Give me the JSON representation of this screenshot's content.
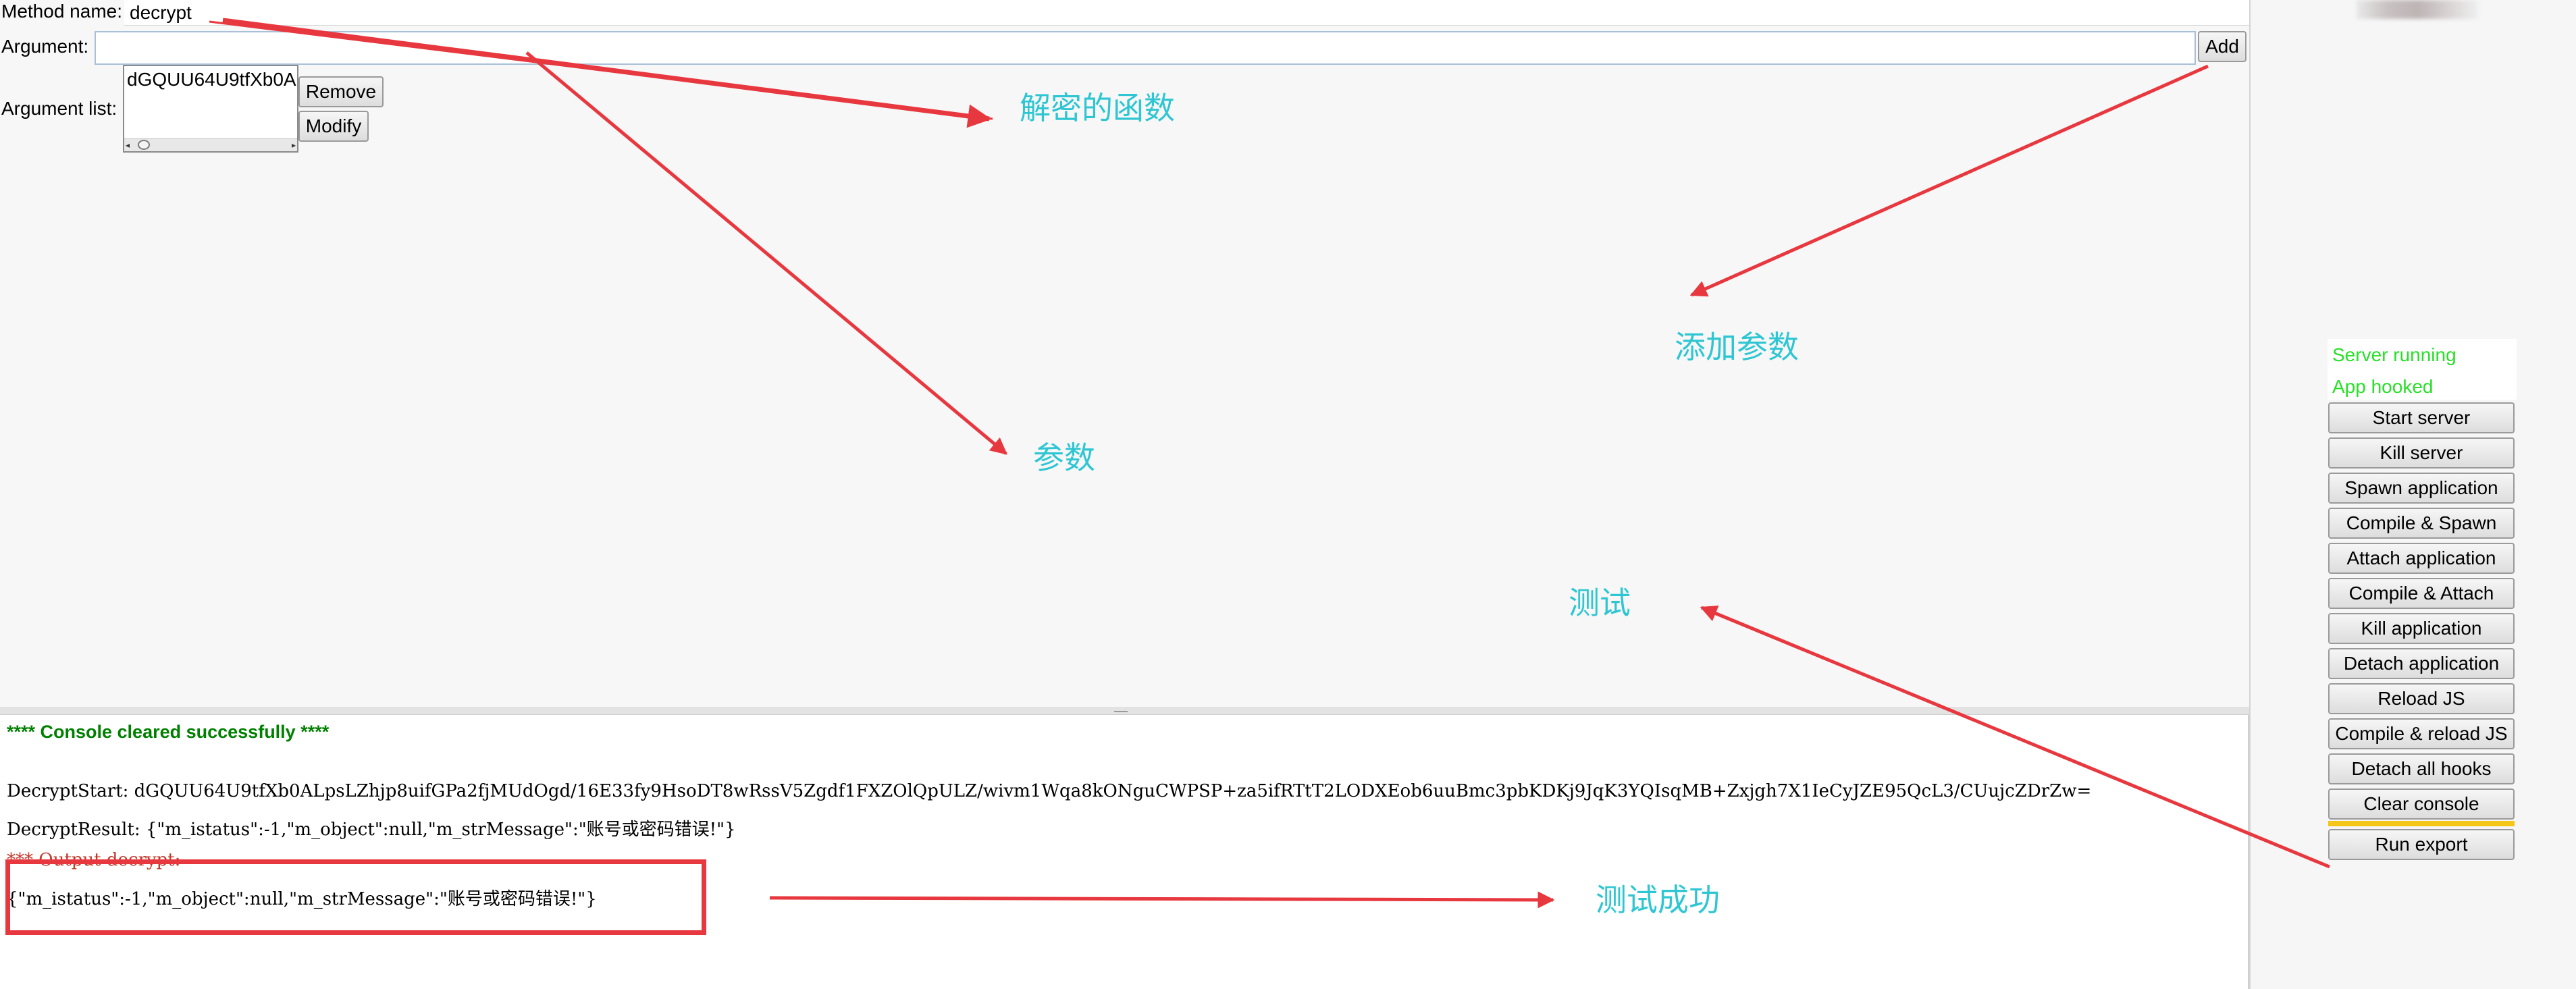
{
  "top_form": {
    "method_name_label": "Method name:",
    "method_name_value": "decrypt",
    "argument_label": "Argument:",
    "argument_value": "",
    "add_button": "Add",
    "argument_list_label": "Argument list:",
    "argument_list_items": [
      "dGQUU64U9tfXb0A"
    ],
    "remove_button": "Remove",
    "modify_button": "Modify"
  },
  "console": {
    "cleared_message": "**** Console cleared successfully ****",
    "decrypt_start": "DecryptStart: dGQUU64U9tfXb0ALpsLZhjp8uifGPa2fjMUdOgd/16E33fy9HsoDT8wRssV5Zgdf1FXZOlQpULZ/wivm1Wqa8kONguCWPSP+za5ifRTtT2LODXEob6uuBmc3pbKDKj9JqK3YQIsqMB+Zxjgh7X1IeCyJZE95QcL3/CUujcZDrZw=",
    "decrypt_result": "DecryptResult: {\"m_istatus\":-1,\"m_object\":null,\"m_strMessage\":\"账号或密码错误!\"}",
    "output_label": "*** Output decrypt:",
    "output_value": "{\"m_istatus\":-1,\"m_object\":null,\"m_strMessage\":\"账号或密码错误!\"}"
  },
  "side_panel": {
    "status_server": "Server running",
    "status_app": "App hooked",
    "status_color": "#27e027",
    "buttons": [
      "Start server",
      "Kill server",
      "Spawn application",
      "Compile & Spawn",
      "Attach application",
      "Compile & Attach",
      "Kill application",
      "Detach application",
      "Reload JS",
      "Compile & reload JS",
      "Detach all hooks",
      "Clear console",
      "Run export"
    ]
  },
  "annotations": {
    "decrypt_function": "解密的函数",
    "add_parameter": "添加参数",
    "parameter": "参数",
    "test": "测试",
    "test_success": "测试成功",
    "annotation_color": "#2ec6d3",
    "arrow_color": "#e8383f"
  }
}
